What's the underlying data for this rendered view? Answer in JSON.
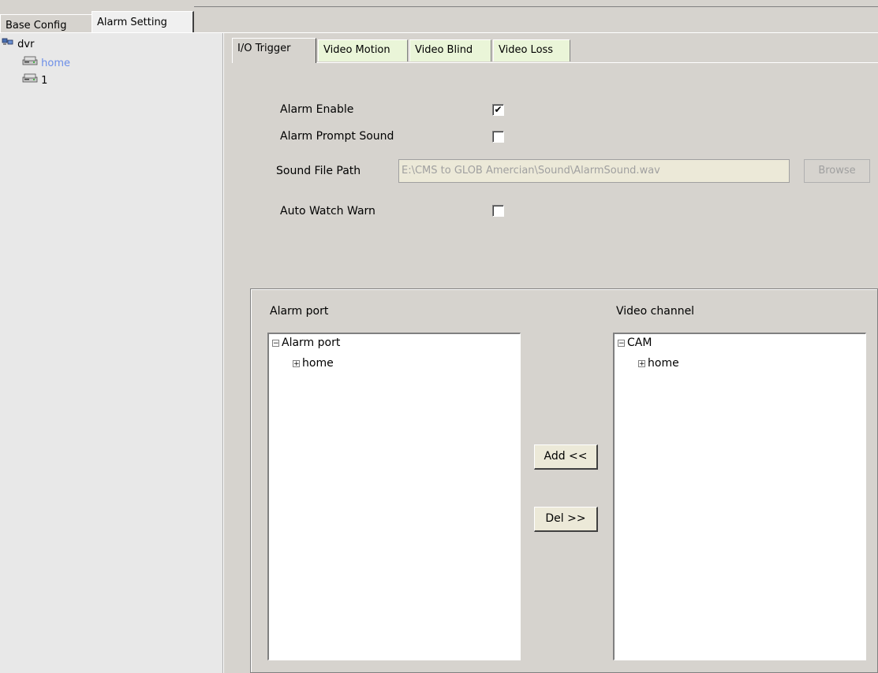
{
  "top_tabs": [
    {
      "label": "Base Config"
    },
    {
      "label": "Alarm Setting"
    }
  ],
  "tree": {
    "root": "dvr",
    "children": [
      {
        "label": "home",
        "color": "#6b8ee8"
      },
      {
        "label": "1"
      }
    ]
  },
  "sub_tabs": [
    {
      "label": "I/O Trigger"
    },
    {
      "label": "Video Motion"
    },
    {
      "label": "Video Blind"
    },
    {
      "label": "Video Loss"
    }
  ],
  "settings": {
    "alarm_enable_label": "Alarm Enable",
    "alarm_enable_checked": true,
    "alarm_prompt_sound_label": "Alarm Prompt Sound",
    "alarm_prompt_sound_checked": false,
    "sound_file_path_label": "Sound File Path",
    "sound_file_path_value": "E:\\CMS to GLOB Amercian\\Sound\\AlarmSound.wav",
    "browse_label": "Browse",
    "auto_watch_warn_label": "Auto Watch Warn",
    "auto_watch_warn_checked": false,
    "check_mark": "✔"
  },
  "alarm_port": {
    "title": "Alarm port",
    "root": "Alarm port",
    "child": "home"
  },
  "video_channel": {
    "title": "Video channel",
    "root": "CAM",
    "child": "home"
  },
  "buttons": {
    "add": "Add <<",
    "del": "Del >>"
  },
  "tree_glyphs": {
    "minus": "−",
    "plus": "+"
  }
}
